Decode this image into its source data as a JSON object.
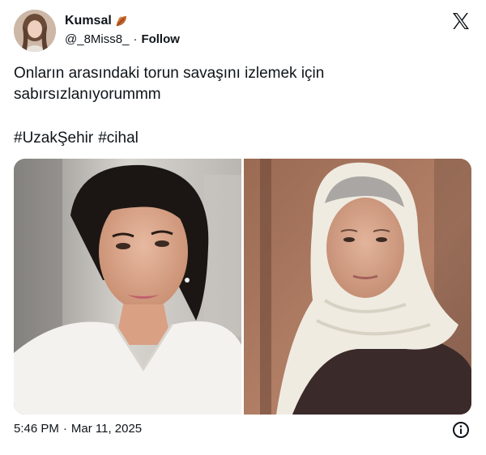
{
  "author": {
    "display_name": "Kumsal",
    "name_emoji": "leaf-icon",
    "handle": "@_8Miss8_",
    "separator": "·",
    "follow_label": "Follow"
  },
  "tweet": {
    "text_lines": [
      "Onların arasındaki torun savaşını izlemek için",
      "sabırsızlanıyorummm"
    ],
    "hashtags": [
      "#UzakŞehir",
      "#cihal"
    ]
  },
  "media": {
    "photos": [
      {
        "subject": "woman-dark-hair-white-shirt"
      },
      {
        "subject": "older-woman-white-headscarf"
      }
    ]
  },
  "footer": {
    "time": "5:46 PM",
    "separator": "·",
    "date": "Mar 11, 2025"
  },
  "icons": {
    "brand": "x-logo-icon",
    "info": "info-icon"
  },
  "colors": {
    "text": "#0f1419",
    "leaf": "#c1642a",
    "background": "#ffffff"
  }
}
